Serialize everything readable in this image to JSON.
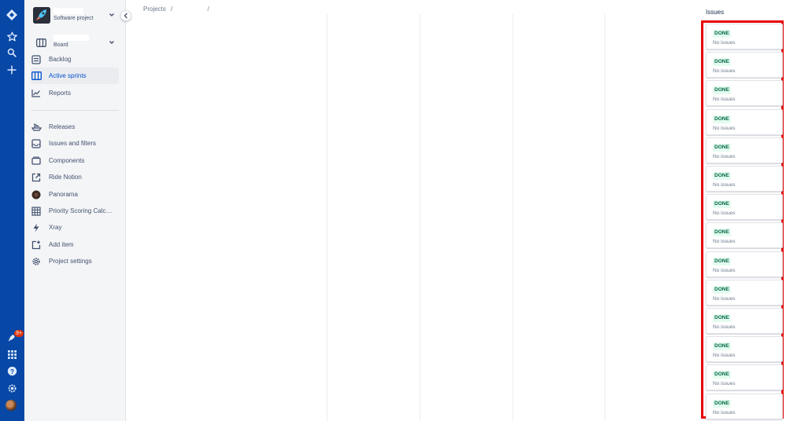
{
  "global_nav": {
    "notification_badge": "9+",
    "icons": [
      "jira-logo-icon",
      "star-icon",
      "search-icon",
      "plus-icon",
      "rocket-icon",
      "apps-grid-icon",
      "help-icon",
      "settings-icon",
      "user-avatar"
    ]
  },
  "sidebar": {
    "project_type": "Software project",
    "board_subtitle": "Board",
    "items": [
      {
        "label": "Backlog",
        "icon": "backlog-icon",
        "active": false
      },
      {
        "label": "Active sprints",
        "icon": "board-icon",
        "active": true
      },
      {
        "label": "Reports",
        "icon": "reports-icon",
        "active": false
      },
      {
        "label": "Releases",
        "icon": "releases-icon",
        "active": false
      },
      {
        "label": "Issues and filters",
        "icon": "issues-icon",
        "active": false
      },
      {
        "label": "Components",
        "icon": "components-icon",
        "active": false
      },
      {
        "label": "Ride Notion",
        "icon": "external-link-icon",
        "active": false
      },
      {
        "label": "Panorama",
        "icon": "panorama-icon",
        "active": false
      },
      {
        "label": "Priority Scoring Calcu…",
        "icon": "table-icon",
        "active": false
      },
      {
        "label": "Xray",
        "icon": "xray-icon",
        "active": false
      },
      {
        "label": "Add item",
        "icon": "add-item-icon",
        "active": false
      },
      {
        "label": "Project settings",
        "icon": "settings-icon",
        "active": false
      }
    ]
  },
  "breadcrumb": {
    "projects": "Projects",
    "sep1": "/",
    "sep2": "/"
  },
  "issues_panel": {
    "heading": "Issues",
    "cards": [
      {
        "status": "DONE",
        "text": "No issues"
      },
      {
        "status": "DONE",
        "text": "No issues"
      },
      {
        "status": "DONE",
        "text": "No issues"
      },
      {
        "status": "DONE",
        "text": "No issues"
      },
      {
        "status": "DONE",
        "text": "No issues"
      },
      {
        "status": "DONE",
        "text": "No issues"
      },
      {
        "status": "DONE",
        "text": "No issues"
      },
      {
        "status": "DONE",
        "text": "No issues"
      },
      {
        "status": "DONE",
        "text": "No issues"
      },
      {
        "status": "DONE",
        "text": "No issues"
      },
      {
        "status": "DONE",
        "text": "No issues"
      },
      {
        "status": "DONE",
        "text": "No issues"
      },
      {
        "status": "DONE",
        "text": "No issues"
      },
      {
        "status": "DONE",
        "text": "No issues"
      }
    ]
  },
  "colors": {
    "global_nav": "#0747a6",
    "highlight_border": "#e60000",
    "done_text": "#006644",
    "done_bg": "#e3fcef"
  }
}
